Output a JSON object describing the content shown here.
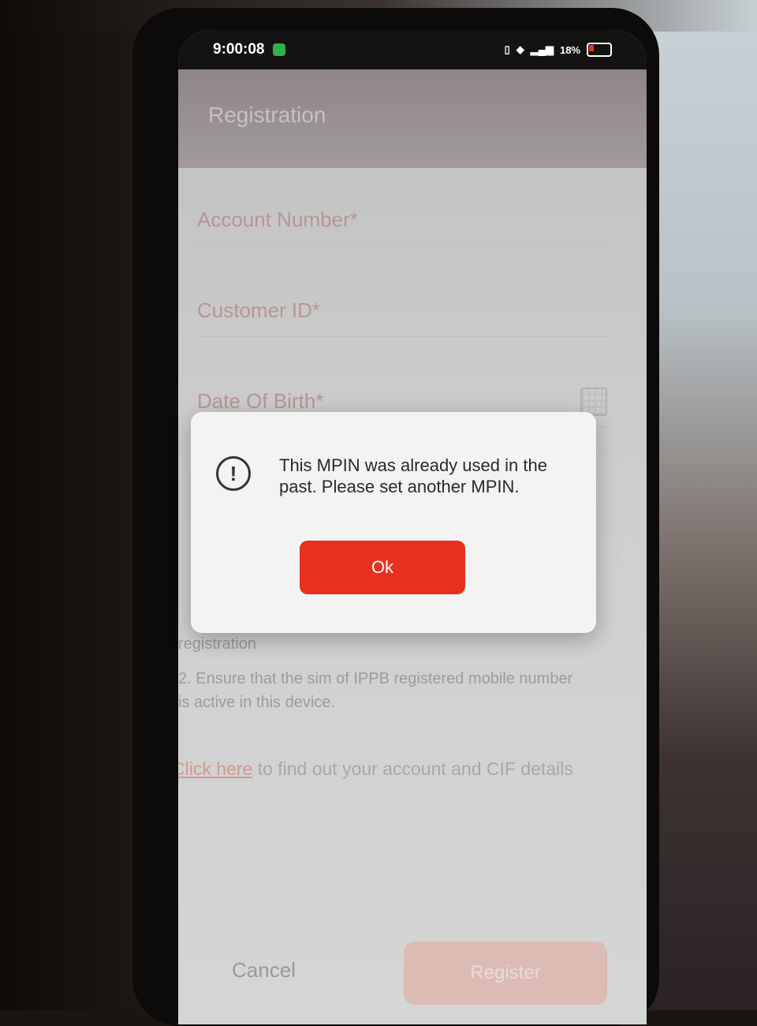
{
  "status_bar": {
    "time": "9:00:08",
    "battery": "18%"
  },
  "app": {
    "title": "Registration"
  },
  "form": {
    "account_number_label": "Account Number*",
    "customer_id_label": "Customer ID*",
    "dob_label": "Date Of Birth*"
  },
  "notes": {
    "note_1_fragment": "registration",
    "note_2": "2. Ensure that the sim of IPPB registered mobile number is active in this device."
  },
  "help": {
    "link": "Click here",
    "text": " to find out your account and CIF details"
  },
  "buttons": {
    "cancel": "Cancel",
    "register": "Register"
  },
  "dialog": {
    "message": "This MPIN was already used in the past. Please set another MPIN.",
    "ok": "Ok"
  },
  "colors": {
    "accent": "#e6311e",
    "dialog_bg": "#f3f3f3"
  }
}
